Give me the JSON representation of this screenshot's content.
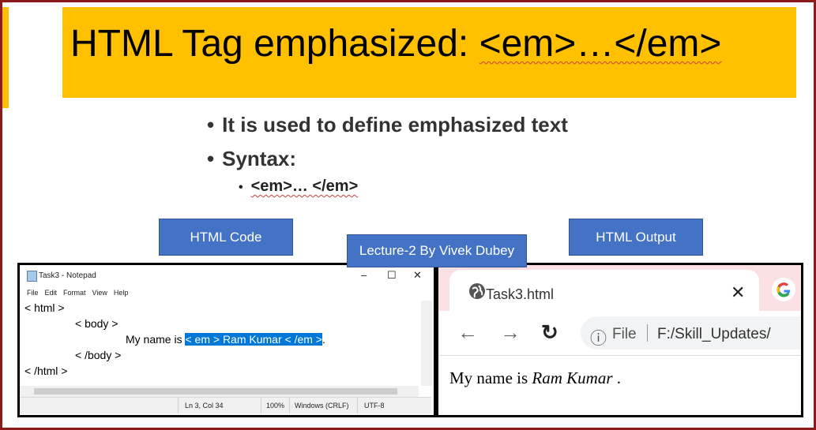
{
  "slide": {
    "title_prefix": "HTML Tag emphasized: ",
    "title_code": "<em>…</em>",
    "bullets": [
      "It is used to define emphasized text",
      "Syntax:"
    ],
    "sub_bullet": "<em>… </em>",
    "bullet_char": "•"
  },
  "labels": {
    "html_code": "HTML Code",
    "html_output": "HTML Output",
    "lecture": "Lecture-2 By Vivek Dubey"
  },
  "notepad": {
    "title": "Task3 - Notepad",
    "controls": [
      "–",
      "☐",
      "✕"
    ],
    "menu": [
      "File",
      "Edit",
      "Format",
      "View",
      "Help"
    ],
    "lines": [
      "< html >",
      "< body >",
      "My name is ",
      "< /body >",
      "< /html >"
    ],
    "selected_text": "< em > Ram Kumar < /em >",
    "trailing": ".",
    "status": {
      "position": "Ln 3, Col 34",
      "zoom": "100%",
      "line_ending": "Windows (CRLF)",
      "encoding": "UTF-8"
    }
  },
  "browser": {
    "tab_title": "Task3.html",
    "tab_close": "✕",
    "nav": {
      "back": "←",
      "forward": "→",
      "reload": "↻",
      "info": "ⓘ"
    },
    "omnibox_scheme": "File",
    "omnibox_path": "F:/Skill_Updates/",
    "page_text_prefix": "My name is ",
    "page_text_em": "Ram Kumar",
    "page_text_suffix": " ."
  },
  "colors": {
    "title_band": "#ffc000",
    "frame": "#8b1a1a",
    "label_blue": "#4472c4",
    "selection": "#0078d7",
    "chrome_tabbar": "#fce1e4"
  }
}
